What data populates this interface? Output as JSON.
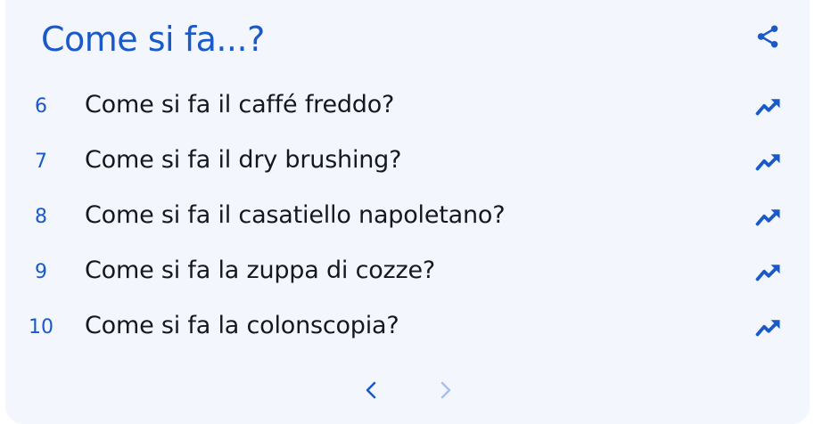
{
  "header": {
    "title": "Come si fa...?",
    "share_icon": "share-icon"
  },
  "items": [
    {
      "rank": "6",
      "query": "Come si fa il caffé freddo?",
      "trend_icon": "trending-up-icon"
    },
    {
      "rank": "7",
      "query": "Come si fa il dry brushing?",
      "trend_icon": "trending-up-icon"
    },
    {
      "rank": "8",
      "query": "Come si fa il casatiello napoletano?",
      "trend_icon": "trending-up-icon"
    },
    {
      "rank": "9",
      "query": "Come si fa la zuppa di cozze?",
      "trend_icon": "trending-up-icon"
    },
    {
      "rank": "10",
      "query": "Come si fa la colonscopia?",
      "trend_icon": "trending-up-icon"
    }
  ],
  "pagination": {
    "prev_icon": "chevron-left-icon",
    "next_icon": "chevron-right-icon"
  },
  "colors": {
    "accent": "#1a5ac8",
    "card_background": "#f3f6fd",
    "text": "#16181d",
    "disabled": "#a8c1ec"
  }
}
